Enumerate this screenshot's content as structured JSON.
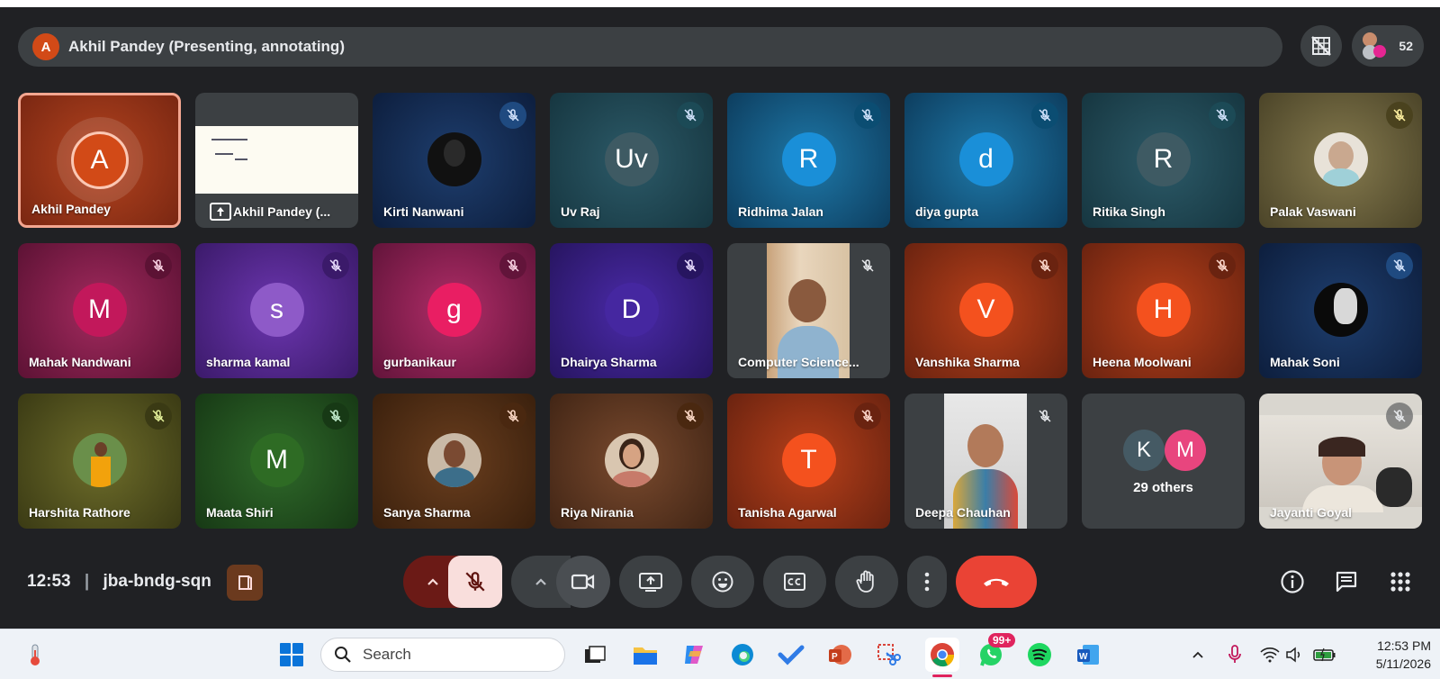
{
  "meeting": {
    "presenter_initial": "A",
    "presenter_banner": "Akhil Pandey (Presenting, annotating)",
    "participant_count": "52",
    "time": "12:53",
    "code": "jba-bndg-sqn"
  },
  "tiles": [
    {
      "name": "Akhil Pandey",
      "initial": "A"
    },
    {
      "name": "Akhil Pandey (..."
    },
    {
      "name": "Kirti Nanwani"
    },
    {
      "name": "Uv Raj",
      "initial": "Uv"
    },
    {
      "name": "Ridhima Jalan",
      "initial": "R"
    },
    {
      "name": "diya gupta",
      "initial": "d"
    },
    {
      "name": "Ritika Singh",
      "initial": "R"
    },
    {
      "name": "Palak Vaswani"
    },
    {
      "name": "Mahak Nandwani",
      "initial": "M"
    },
    {
      "name": "sharma kamal",
      "initial": "s"
    },
    {
      "name": "gurbanikaur",
      "initial": "g"
    },
    {
      "name": "Dhairya Sharma",
      "initial": "D"
    },
    {
      "name": "Computer Science..."
    },
    {
      "name": "Vanshika Sharma",
      "initial": "V"
    },
    {
      "name": "Heena Moolwani",
      "initial": "H"
    },
    {
      "name": "Mahak Soni"
    },
    {
      "name": "Harshita Rathore"
    },
    {
      "name": "Maata Shiri",
      "initial": "M"
    },
    {
      "name": "Sanya Sharma"
    },
    {
      "name": "Riya Nirania"
    },
    {
      "name": "Tanisha Agarwal",
      "initial": "T"
    },
    {
      "name": "Deepa Chauhan"
    },
    {
      "name": "29 others",
      "initial_a": "K",
      "initial_b": "M"
    },
    {
      "name": "Jayanti Goyal"
    }
  ],
  "taskbar": {
    "search_placeholder": "Search",
    "whatsapp_badge": "99+",
    "time": "12:53 PM",
    "date": "5/11/2026"
  },
  "colors": {
    "end_call": "#ea4335",
    "mic_off_bg": "#f9dedc",
    "mic_off_group": "#6b1a16",
    "bg": "#202124"
  }
}
